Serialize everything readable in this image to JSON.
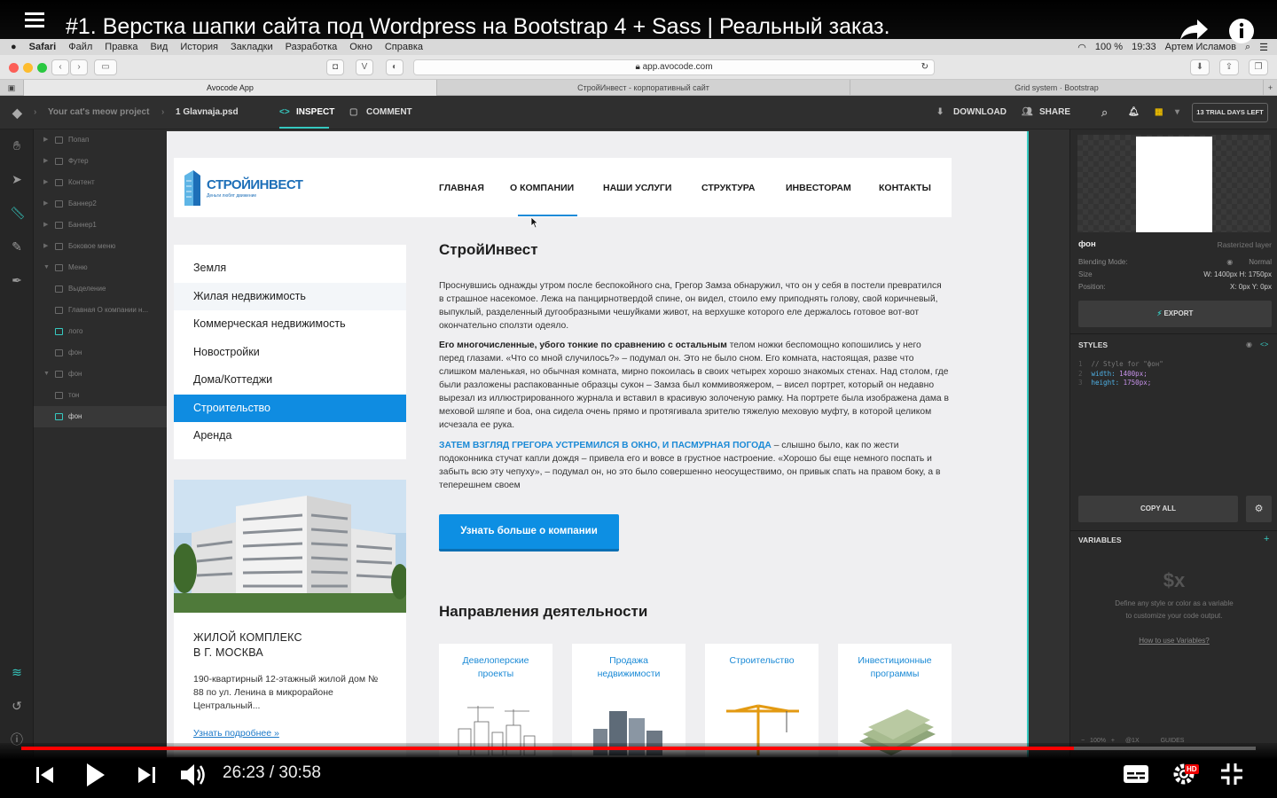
{
  "video": {
    "title": "#1. Верстка шапки сайта под Wordpress на Bootstrap 4 + Sass | Реальный заказ.",
    "time": "26:23 / 30:58",
    "progress_pct": 85.3,
    "hd_badge": "HD"
  },
  "macbar": {
    "app": "Safari",
    "menus": [
      "Файл",
      "Правка",
      "Вид",
      "История",
      "Закладки",
      "Разработка",
      "Окно",
      "Справка"
    ],
    "battery": "100 %",
    "clock": "19:33",
    "user": "Артем Исламов"
  },
  "browser": {
    "url": "app.avocode.com",
    "tabs": [
      "Avocode App",
      "СтройИнвест - корпоративный сайт",
      "Grid system · Bootstrap"
    ]
  },
  "avocode": {
    "project": "Your cat's meow project",
    "file": "1 Glavnaja.psd",
    "inspect": "INSPECT",
    "comment": "COMMENT",
    "download": "DOWNLOAD",
    "share": "SHARE",
    "trial": "13 TRIAL DAYS LEFT",
    "layers": [
      {
        "name": "Попап",
        "type": "folder"
      },
      {
        "name": "Футер",
        "type": "folder"
      },
      {
        "name": "Контент",
        "type": "folder"
      },
      {
        "name": "Баннер2",
        "type": "folder"
      },
      {
        "name": "Баннер1",
        "type": "folder"
      },
      {
        "name": "Боковое меню",
        "type": "folder"
      },
      {
        "name": "Меню",
        "type": "folder"
      },
      {
        "name": "Выделение",
        "type": "image"
      },
      {
        "name": "Главная О компании н...",
        "type": "text"
      },
      {
        "name": "лого",
        "type": "image"
      },
      {
        "name": "фон",
        "type": "shape"
      },
      {
        "name": "фон",
        "type": "folder"
      },
      {
        "name": "тон",
        "type": "image"
      },
      {
        "name": "фон",
        "type": "image"
      }
    ]
  },
  "site": {
    "logo_title": "СТРОЙИНВЕСТ",
    "logo_slogan": "Деньги любят движение",
    "nav": [
      "ГЛАВНАЯ",
      "О КОМПАНИИ",
      "НАШИ УСЛУГИ",
      "СТРУКТУРА",
      "ИНВЕСТОРАМ",
      "КОНТАКТЫ"
    ],
    "side_menu": [
      "Земля",
      "Жилая недвижимость",
      "Коммерческая недвижимость",
      "Новостройки",
      "Дома/Коттеджи",
      "Строительство",
      "Аренда"
    ],
    "card": {
      "title_line1": "ЖИЛОЙ КОМПЛЕКС",
      "title_line2": "В Г. МОСКВА",
      "text": "190-квартирный 12-этажный жилой дом № 88 по ул. Ленина в микрорайоне Центральный...",
      "link": "Узнать подробнее »"
    },
    "heading": "СтройИнвест",
    "para1": "Проснувшись однажды утром после беспокойного сна, Грегор Замза обнаружил, что он у себя в постели превратился в страшное насекомое. Лежа на панцирнотвердой спине, он видел, стоило ему приподнять голову, свой коричневый, выпуклый, разделенный дугообразными чешуйками живот, на верхушке которого еле держалось готовое вот-вот окончательно сползти одеяло.",
    "para2_bold": "Его многочисленные, убого тонкие по сравнению с остальным",
    "para2_rest": " телом ножки беспомощно копошились у него перед глазами. «Что со мной случилось?» – подумал он. Это не было сном. Его комната, настоящая, разве что слишком маленькая, но обычная комната, мирно покоилась в своих четырех хорошо знакомых стенах. Над столом, где были разложены распакованные образцы сукон – Замза был коммивояжером, – висел портрет, который он недавно вырезал из иллюстрированного журнала и вставил в красивую золоченую рамку. На портрете была изображена дама в меховой шляпе и боа, она сидела очень прямо и протягивала зрителю тяжелую меховую муфту, в которой целиком исчезала ее рука.",
    "para3_hl": "ЗАТЕМ ВЗГЛЯД ГРЕГОРА УСТРЕМИЛСЯ В ОКНО, И ПАСМУРНАЯ ПОГОДА",
    "para3_rest": " – слышно было, как по жести подоконника стучат капли дождя – привела его и вовсе в грустное настроение. «Хорошо бы еще немного поспать и забыть всю эту чепуху», – подумал он, но это было совершенно неосуществимо, он привык спать на правом боку, а в теперешнем своем",
    "cta": "Узнать больше о компании",
    "section2": "Направления деятельности",
    "directions": [
      {
        "l1": "Девелоперские",
        "l2": "проекты"
      },
      {
        "l1": "Продажа",
        "l2": "недвижимости"
      },
      {
        "l1": "Строительство",
        "l2": ""
      },
      {
        "l1": "Инвестиционные",
        "l2": "программы"
      }
    ]
  },
  "inspector": {
    "layer_name": "фон",
    "layer_type": "Rasterized layer",
    "blending_label": "Blending Mode:",
    "blending_value": "Normal",
    "size_label": "Size",
    "size_w": "W: 1400px",
    "size_h": "H: 1750px",
    "position_label": "Position:",
    "pos_x": "X: 0px",
    "pos_y": "Y: 0px",
    "export": "EXPORT",
    "styles": "STYLES",
    "code_comment": "// Style for \"фон\"",
    "code_width_prop": "width:",
    "code_width_val": "1400px;",
    "code_height_prop": "height:",
    "code_height_val": "1750px;",
    "copy_all": "COPY ALL",
    "variables": "VARIABLES",
    "vars_symbol": "$x",
    "vars_text1": "Define any style or color as a variable",
    "vars_text2": "to customize your code output.",
    "vars_link": "How to use Variables?",
    "zoom": "100%",
    "scale": "@1X",
    "guides": "GUIDES"
  },
  "colors": {
    "accent_blue": "#0f8ce1",
    "progress_red": "#ff0000",
    "artboard_outline": "#36c9c0"
  }
}
